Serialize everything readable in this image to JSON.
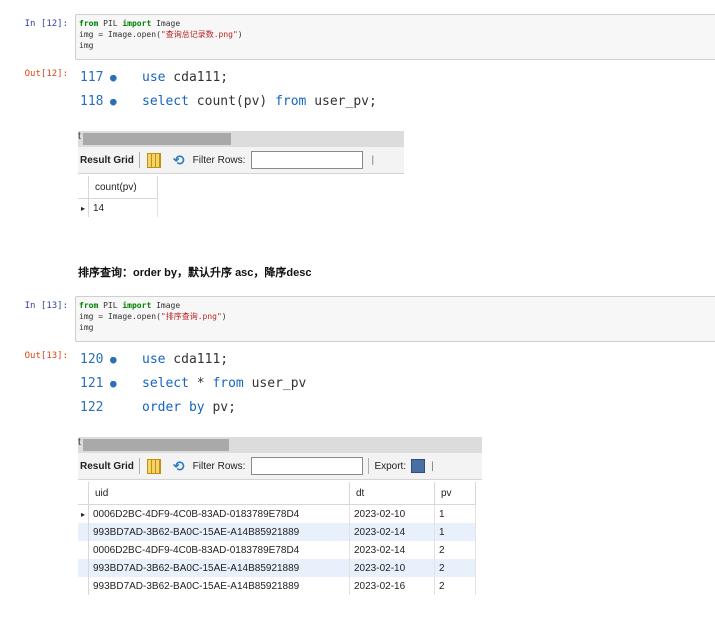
{
  "cells": [
    {
      "in_prompt": "In  [12]:",
      "out_prompt": "Out[12]:",
      "code": {
        "l1_from": "from",
        "l1_mod": " PIL ",
        "l1_import": "import",
        "l1_rest": " Image",
        "l2_a": "img = Image.open(",
        "l2_str": "\"查询总记录数.png\"",
        "l2_b": ")",
        "l3": "img"
      },
      "sql_lines": [
        {
          "num": "117",
          "dot": "●",
          "kw1": "use",
          "txt1": " cda111;"
        },
        {
          "num": "118",
          "dot": "●",
          "kw1": "select",
          "txt1": " count(pv) ",
          "kw2": "from",
          "txt2": " user_pv;"
        }
      ],
      "toolbar": {
        "tick": "t",
        "result_grid": "Result Grid",
        "filter_rows": "Filter Rows:",
        "cursor": "|"
      },
      "columns": [
        "count(pv)"
      ],
      "rows": [
        [
          "14"
        ]
      ]
    },
    {
      "in_prompt": "In  [13]:",
      "out_prompt": "Out[13]:",
      "code": {
        "l1_from": "from",
        "l1_mod": " PIL ",
        "l1_import": "import",
        "l1_rest": " Image",
        "l2_a": "img = Image.open(",
        "l2_str": "\"排序查询.png\"",
        "l2_b": ")",
        "l3": "img"
      },
      "sql_lines": [
        {
          "num": "120",
          "dot": "●",
          "kw1": "use",
          "txt1": " cda111;"
        },
        {
          "num": "121",
          "dot": "●",
          "kw1": "select",
          "txt1": " * ",
          "kw2": "from",
          "txt2": " user_pv"
        },
        {
          "num": "122",
          "dot": "",
          "kw1": "order by",
          "txt1": " pv;"
        }
      ],
      "toolbar": {
        "tick": "t",
        "result_grid": "Result Grid",
        "filter_rows": "Filter Rows:",
        "export": "Export:",
        "cursor": "|"
      },
      "columns": [
        "uid",
        "dt",
        "pv"
      ],
      "rows": [
        [
          "0006D2BC-4DF9-4C0B-83AD-0183789E78D4",
          "2023-02-10",
          "1"
        ],
        [
          "993BD7AD-3B62-BA0C-15AE-A14B85921889",
          "2023-02-14",
          "1"
        ],
        [
          "0006D2BC-4DF9-4C0B-83AD-0183789E78D4",
          "2023-02-14",
          "2"
        ],
        [
          "993BD7AD-3B62-BA0C-15AE-A14B85921889",
          "2023-02-10",
          "2"
        ],
        [
          "993BD7AD-3B62-BA0C-15AE-A14B85921889",
          "2023-02-16",
          "2"
        ]
      ]
    }
  ],
  "markdown_heading": "排序查询：order by，默认升序 asc，降序desc",
  "row_marker": "▸"
}
